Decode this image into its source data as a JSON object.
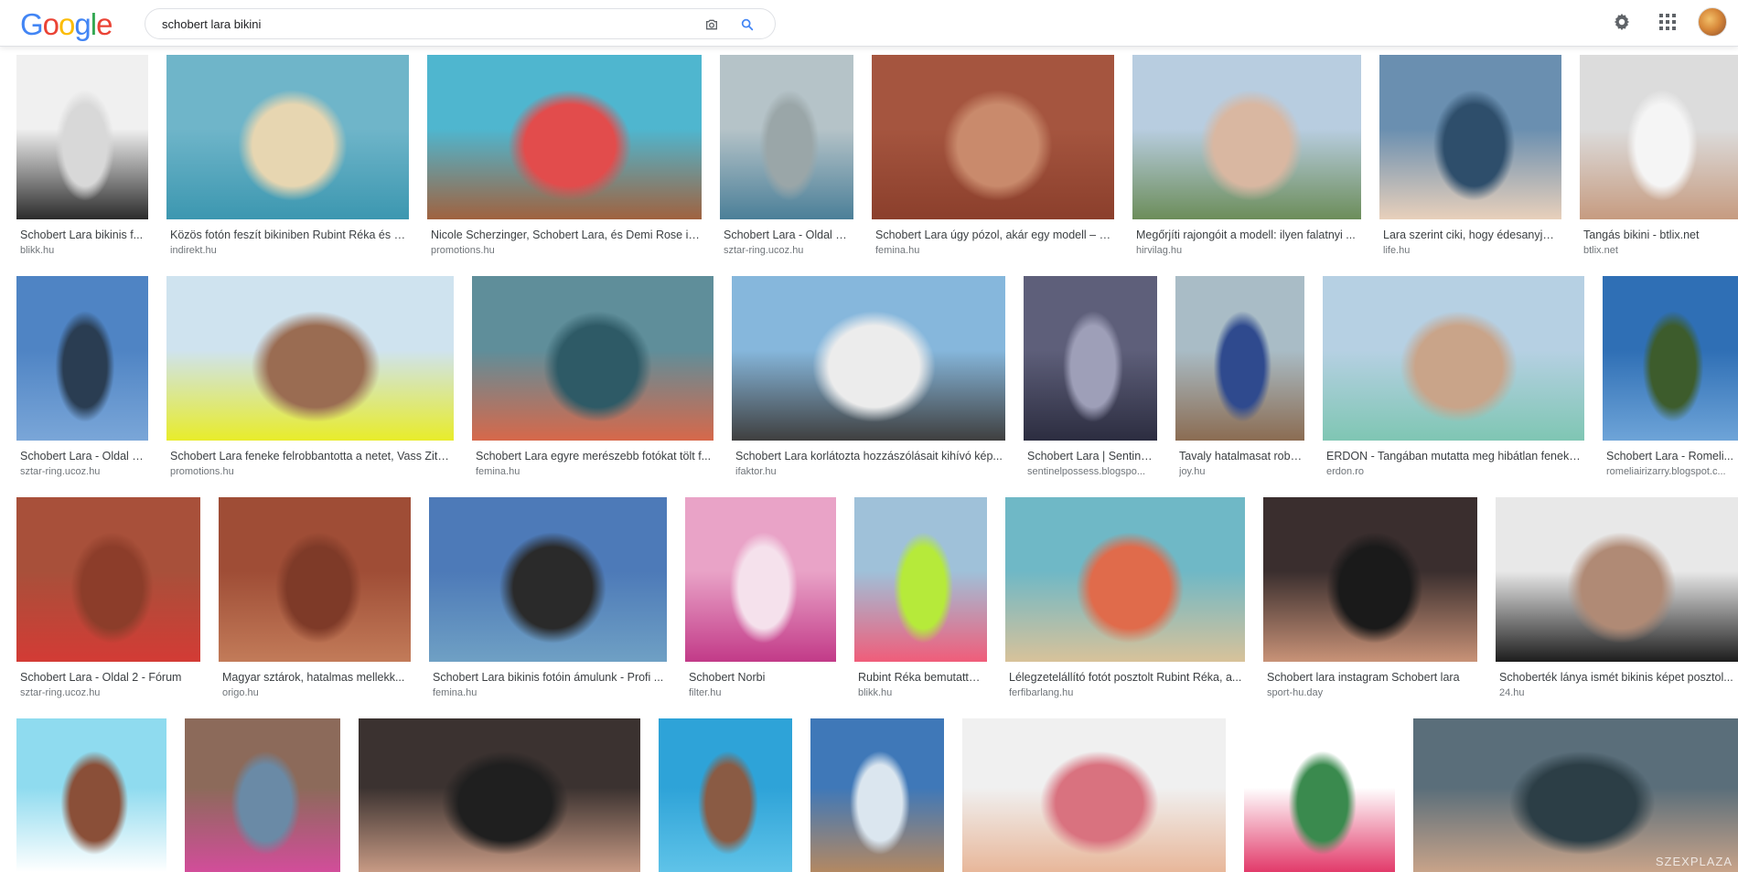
{
  "search": {
    "query": "schobert lara bikini"
  },
  "logo": {
    "letters": [
      {
        "ch": "G",
        "color": "#4285F4"
      },
      {
        "ch": "o",
        "color": "#EA4335"
      },
      {
        "ch": "o",
        "color": "#FBBC05"
      },
      {
        "ch": "g",
        "color": "#4285F4"
      },
      {
        "ch": "l",
        "color": "#34A853"
      },
      {
        "ch": "e",
        "color": "#EA4335"
      }
    ]
  },
  "icons": {
    "camera": "camera-icon",
    "search": "search-icon",
    "settings": "gear-icon",
    "apps": "apps-grid-icon",
    "account": "avatar"
  },
  "colors": {
    "caption": "#3c4043",
    "domain": "#70757a",
    "accent": "#4285F4"
  },
  "results": [
    {
      "title": "Schobert Lara bikinis f...",
      "domain": "blikk.hu",
      "colors": [
        "#f0f0f0",
        "#2b2b2b",
        "#d8d8d8"
      ]
    },
    {
      "title": "Közös fotón feszít bikiniben Rubint Réka és a...",
      "domain": "indirekt.hu",
      "colors": [
        "#6fb5c9",
        "#3c97b0",
        "#e7d6b1"
      ]
    },
    {
      "title": "Nicole Scherzinger, Schobert Lara, és Demi Rose is ...",
      "domain": "promotions.hu",
      "colors": [
        "#4fb6cf",
        "#a0623f",
        "#e24c4c"
      ]
    },
    {
      "title": "Schobert Lara - Oldal 4 ...",
      "domain": "sztar-ring.ucoz.hu",
      "colors": [
        "#b5c3c8",
        "#4b7f98",
        "#9aa6a8"
      ]
    },
    {
      "title": "Schobert Lara úgy pózol, akár egy modell – S...",
      "domain": "femina.hu",
      "colors": [
        "#a5553f",
        "#8b3f2c",
        "#c98a6c"
      ]
    },
    {
      "title": "Megőrjíti rajongóit a modell: ilyen falatnyi ...",
      "domain": "hirvilag.hu",
      "colors": [
        "#b8cde0",
        "#6c8d5a",
        "#d9b7a1"
      ]
    },
    {
      "title": "Lara szerint ciki, hogy édesanyja,...",
      "domain": "life.hu",
      "colors": [
        "#6a8fb0",
        "#e8d0bb",
        "#2e4e6b"
      ]
    },
    {
      "title": "Tangás bikini - btlix.net",
      "domain": "btlix.net",
      "colors": [
        "#dcdcdc",
        "#c69b80",
        "#f5f5f5"
      ]
    },
    {
      "title": "Schobert Lara - Oldal 4 ...",
      "domain": "sztar-ring.ucoz.hu",
      "colors": [
        "#4f84c4",
        "#7aa6d8",
        "#2a3d52"
      ]
    },
    {
      "title": "Schobert Lara feneke felrobbantotta a netet, Vass Zita...",
      "domain": "promotions.hu",
      "colors": [
        "#cfe3ef",
        "#e8ec2a",
        "#9a6c52"
      ]
    },
    {
      "title": "Schobert Lara egyre merészebb fotókat tölt f...",
      "domain": "femina.hu",
      "colors": [
        "#5f8e9a",
        "#d7684a",
        "#2e5a66"
      ]
    },
    {
      "title": "Schobert Lara korlátozta hozzászólásait kihívó kép...",
      "domain": "ifaktor.hu",
      "colors": [
        "#86b7dc",
        "#3f3f3f",
        "#ececec"
      ]
    },
    {
      "title": "Schobert Lara | Sentine...",
      "domain": "sentinelpossess.blogspo...",
      "colors": [
        "#5e5f7a",
        "#2c2d40",
        "#9e9fb8"
      ]
    },
    {
      "title": "Tavaly hatalmasat robb...",
      "domain": "joy.hu",
      "colors": [
        "#a9bcc6",
        "#8b6c52",
        "#2f4a8e"
      ]
    },
    {
      "title": "ERDON - Tangában mutatta meg hibátlan feneké...",
      "domain": "erdon.ro",
      "colors": [
        "#b6d0e3",
        "#7fc6b3",
        "#c9a489"
      ]
    },
    {
      "title": "Schobert Lara - Romeli...",
      "domain": "romeliairizarry.blogspot.c...",
      "colors": [
        "#2f6fb5",
        "#6ea4d8",
        "#3d5c2c"
      ]
    },
    {
      "title": "Schobert Lara - Oldal 2 - Fórum",
      "domain": "sztar-ring.ucoz.hu",
      "colors": [
        "#a8503a",
        "#d33b35",
        "#8c3d2a"
      ]
    },
    {
      "title": "Magyar sztárok, hatalmas mellekk...",
      "domain": "origo.hu",
      "colors": [
        "#9f4d36",
        "#c27b59",
        "#7e3a28"
      ]
    },
    {
      "title": "Schobert Lara bikinis fotóin ámulunk - Profi ...",
      "domain": "femina.hu",
      "colors": [
        "#4d7ab8",
        "#6fa0c4",
        "#2a2a2a"
      ]
    },
    {
      "title": "Schobert Norbi",
      "domain": "filter.hu",
      "colors": [
        "#e9a3c7",
        "#c23a88",
        "#f5e1ec"
      ]
    },
    {
      "title": "Rubint Réka bemutatta ...",
      "domain": "blikk.hu",
      "colors": [
        "#9fc1d9",
        "#f05d7a",
        "#b6ea3a"
      ]
    },
    {
      "title": "Lélegzetelállító fotót posztolt Rubint Réka, a...",
      "domain": "ferfibarlang.hu",
      "colors": [
        "#6fb8c6",
        "#d8c29a",
        "#e06b4b"
      ]
    },
    {
      "title": "Schobert lara instagram Schobert lara",
      "domain": "sport-hu.day",
      "colors": [
        "#3a2e2e",
        "#c89277",
        "#1a1a1a"
      ]
    },
    {
      "title": "Schoberték lánya ismét bikinis képet posztol...",
      "domain": "24.hu",
      "colors": [
        "#e8e8e8",
        "#1d1d1d",
        "#b08a75"
      ]
    },
    {
      "title": "",
      "domain": "",
      "colors": [
        "#8fdbef",
        "#ffffff",
        "#8a4f38"
      ]
    },
    {
      "title": "",
      "domain": "",
      "colors": [
        "#8c6a5a",
        "#d24d9a",
        "#6a8aa6"
      ]
    },
    {
      "title": "",
      "domain": "",
      "colors": [
        "#3b3230",
        "#c79a84",
        "#1f1f1f"
      ]
    },
    {
      "title": "",
      "domain": "",
      "colors": [
        "#2ea3d8",
        "#5fc3e8",
        "#8a5b44"
      ]
    },
    {
      "title": "",
      "domain": "",
      "colors": [
        "#3f78b8",
        "#b38862",
        "#dbe6ef"
      ]
    },
    {
      "title": "",
      "domain": "",
      "colors": [
        "#f0f0f0",
        "#e8b79a",
        "#d9727f"
      ]
    },
    {
      "title": "",
      "domain": "",
      "colors": [
        "#ffffff",
        "#e23a6a",
        "#3a8a4e"
      ]
    },
    {
      "title": "",
      "domain": "",
      "colors": [
        "#5a6e7a",
        "#c8a389",
        "#2c3e46"
      ],
      "watermark": "SZEXPLAZA"
    }
  ]
}
